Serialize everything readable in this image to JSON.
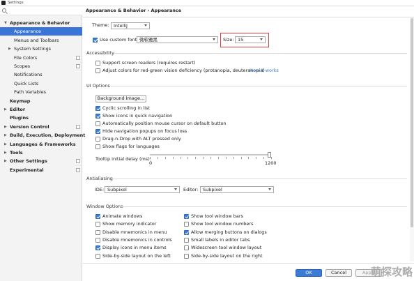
{
  "window": {
    "title": "Settings"
  },
  "sidebar": {
    "items": [
      {
        "label": "Appearance & Behavior",
        "indent": 0,
        "bold": true,
        "expanded": true,
        "arrow": "▼",
        "icon": false
      },
      {
        "label": "Appearance",
        "indent": 1,
        "bold": false,
        "selected": true,
        "icon": false
      },
      {
        "label": "Menus and Toolbars",
        "indent": 1,
        "bold": false,
        "icon": false
      },
      {
        "label": "System Settings",
        "indent": 1,
        "bold": false,
        "arrow": "▶",
        "icon": false
      },
      {
        "label": "File Colors",
        "indent": 1,
        "bold": false,
        "icon": true
      },
      {
        "label": "Scopes",
        "indent": 1,
        "bold": false,
        "icon": true
      },
      {
        "label": "Notifications",
        "indent": 1,
        "bold": false,
        "icon": false
      },
      {
        "label": "Quick Lists",
        "indent": 1,
        "bold": false,
        "icon": false
      },
      {
        "label": "Path Variables",
        "indent": 1,
        "bold": false,
        "icon": false
      },
      {
        "label": "Keymap",
        "indent": 0,
        "bold": true,
        "icon": false
      },
      {
        "label": "Editor",
        "indent": 0,
        "bold": true,
        "arrow": "▶",
        "icon": false
      },
      {
        "label": "Plugins",
        "indent": 0,
        "bold": true,
        "icon": false
      },
      {
        "label": "Version Control",
        "indent": 0,
        "bold": true,
        "arrow": "▶",
        "icon": true
      },
      {
        "label": "Build, Execution, Deployment",
        "indent": 0,
        "bold": true,
        "arrow": "▶",
        "icon": false
      },
      {
        "label": "Languages & Frameworks",
        "indent": 0,
        "bold": true,
        "arrow": "▶",
        "icon": false
      },
      {
        "label": "Tools",
        "indent": 0,
        "bold": true,
        "arrow": "▶",
        "icon": false
      },
      {
        "label": "Other Settings",
        "indent": 0,
        "bold": true,
        "arrow": "▶",
        "icon": true
      },
      {
        "label": "Experimental",
        "indent": 0,
        "bold": true,
        "icon": true
      }
    ]
  },
  "breadcrumb": "Appearance & Behavior  ›  Appearance",
  "theme": {
    "label": "Theme:",
    "value": "IntelliJ"
  },
  "custom_font": {
    "checkbox_label": "Use custom font:",
    "checked": true,
    "value": "微软雅黑"
  },
  "size": {
    "label": "Size:",
    "value": "15"
  },
  "accessibility": {
    "title": "Accessibility",
    "options": [
      {
        "label": "Support screen readers (requires restart)",
        "checked": false
      },
      {
        "label": "Adjust colors for red-green vision deficiency (protanopia, deuteranopia)",
        "checked": false
      }
    ],
    "link": "How it works"
  },
  "ui_options": {
    "title": "UI Options",
    "background_button": "Background Image...",
    "options": [
      {
        "label": "Cyclic scrolling in list",
        "checked": true
      },
      {
        "label": "Show icons in quick navigation",
        "checked": true
      },
      {
        "label": "Automatically position mouse cursor on default button",
        "checked": false
      },
      {
        "label": "Hide navigation popups on focus loss",
        "checked": true
      },
      {
        "label": "Drag-n-Drop with ALT pressed only",
        "checked": false
      },
      {
        "label": "Show flags for languages",
        "checked": false
      }
    ],
    "tooltip_label": "Tooltip initial delay (ms):",
    "tooltip_min": "0",
    "tooltip_max": "1200",
    "tooltip_value_fraction": 1.0
  },
  "antialiasing": {
    "title": "Antialiasing",
    "ide_label": "IDE:",
    "ide_value": "Subpixel",
    "editor_label": "Editor:",
    "editor_value": "Subpixel"
  },
  "window_options": {
    "title": "Window Options",
    "left": [
      {
        "label": "Animate windows",
        "checked": true
      },
      {
        "label": "Show memory indicator",
        "checked": false
      },
      {
        "label": "Disable mnemonics in menu",
        "checked": false
      },
      {
        "label": "Disable mnemonics in controls",
        "checked": false
      },
      {
        "label": "Display icons in menu items",
        "checked": true
      },
      {
        "label": "Side-by-side layout on the left",
        "checked": false
      }
    ],
    "right": [
      {
        "label": "Show tool window bars",
        "checked": true
      },
      {
        "label": "Show tool window numbers",
        "checked": false
      },
      {
        "label": "Allow merging buttons on dialogs",
        "checked": true
      },
      {
        "label": "Small labels in editor tabs",
        "checked": false
      },
      {
        "label": "Widescreen tool window layout",
        "checked": false
      },
      {
        "label": "Side-by-side layout on the right",
        "checked": false
      }
    ]
  },
  "footer": {
    "ok_label": "OK",
    "cancel_label": "Cancel",
    "apply_label": "Apply"
  },
  "watermark": "萌探攻略",
  "colors": {
    "accent": "#3b7bd6",
    "selected": "#3875d7",
    "highlight": "#e03b3b",
    "link": "#3a7bd6"
  }
}
